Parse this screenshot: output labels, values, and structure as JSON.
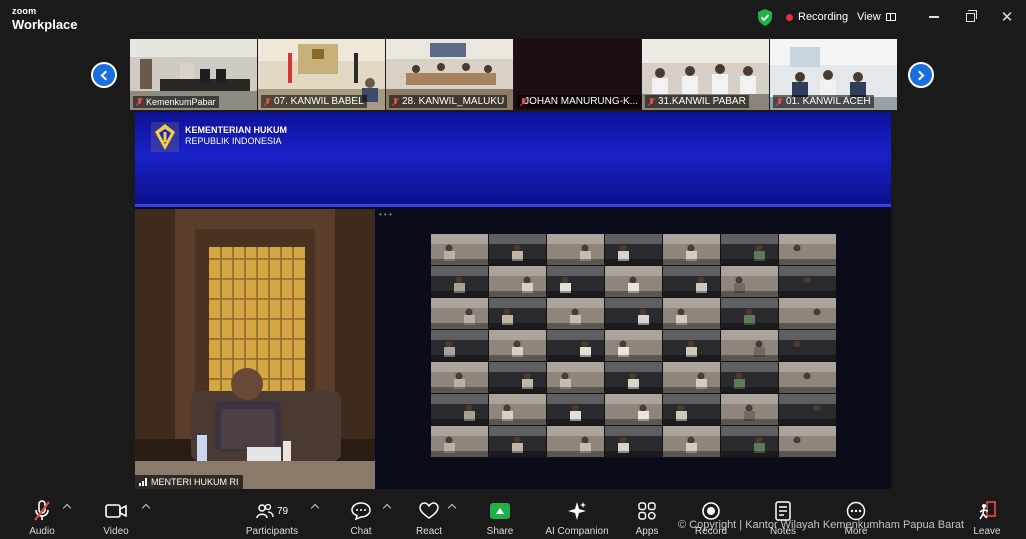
{
  "brand": {
    "top": "zoom",
    "bottom": "Workplace"
  },
  "titlebar": {
    "recording_label": "Recording",
    "view_label": "View",
    "icons": [
      "shield-check-icon",
      "record-dot-icon",
      "grid-view-icon",
      "minimize-icon",
      "restore-icon",
      "close-icon"
    ]
  },
  "colors": {
    "accent": "#1a6fe0",
    "record": "#e8323c",
    "share": "#22b04a",
    "shield": "#22b04a",
    "banner": "#1a21c8"
  },
  "strip": [
    {
      "label": "KemenkumPabar",
      "muted": true
    },
    {
      "label": "07. KANWIL BABEL",
      "muted": true
    },
    {
      "label": "28. KANWIL_MALUKU",
      "muted": true
    },
    {
      "label": "JOHAN MANURUNG-K...",
      "muted": true
    },
    {
      "label": "31.KANWIL PABAR",
      "muted": true
    },
    {
      "label": "01. KANWIL ACEH",
      "muted": true
    }
  ],
  "shared_screen": {
    "ministry_name": "KEMENTERIAN HUKUM",
    "ministry_sub": "REPUBLIK INDONESIA",
    "speaker_name": "MENTERI HUKUM RI"
  },
  "toolbar": {
    "audio": "Audio",
    "video": "Video",
    "participants": "Participants",
    "participants_count": "79",
    "chat": "Chat",
    "react": "React",
    "share": "Share",
    "ai": "AI Companion",
    "apps": "Apps",
    "record": "Record",
    "notes": "Notes",
    "more": "More",
    "leave": "Leave"
  },
  "copyright": "© Copyright | Kantor Wilayah Kemenkumham Papua Barat"
}
